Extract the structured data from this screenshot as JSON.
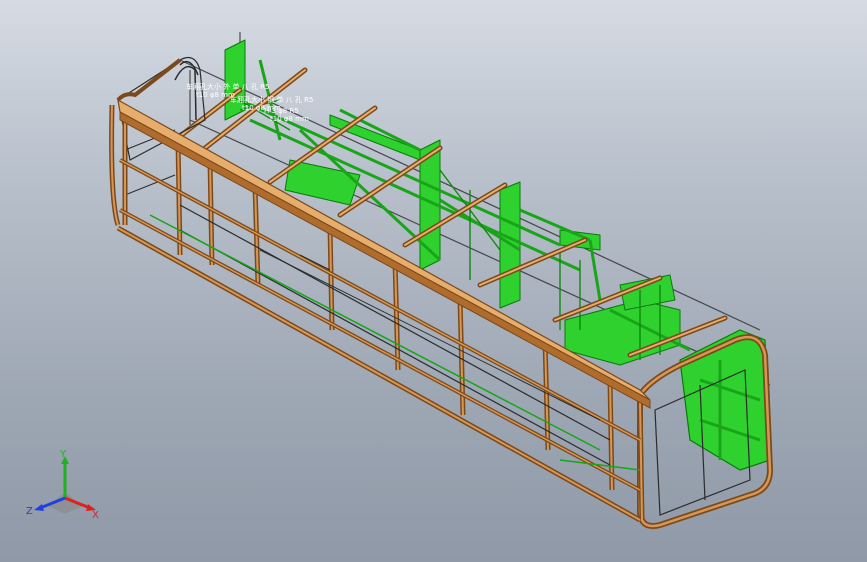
{
  "viewport": {
    "background_top": "#d6dbe3",
    "background_bottom": "#8f99a7"
  },
  "model": {
    "frame_color": "#c0803f",
    "frame_dark": "#7a4a1c",
    "frame_light": "#e7ad6c",
    "internal_color": "#2fd12f",
    "internal_dark": "#0a7a0a",
    "wire_color": "#2b2b2b"
  },
  "annotations": {
    "note_1": "车厢孔大小 外 单 八 孔 R5",
    "note_1_sub": "t10 φ8 mm",
    "note_2": "车厢孔大小 钢 单 八 孔 R5",
    "note_2_sub": "t10 φ8 mm",
    "note_3": "H 3 φ8 R5",
    "note_3_sub": "t10 φ8 mm"
  },
  "triad": {
    "x_label": "X",
    "y_label": "Y",
    "z_label": "Z",
    "x_color": "#e02020",
    "y_color": "#20b020",
    "z_color": "#2040e0"
  }
}
